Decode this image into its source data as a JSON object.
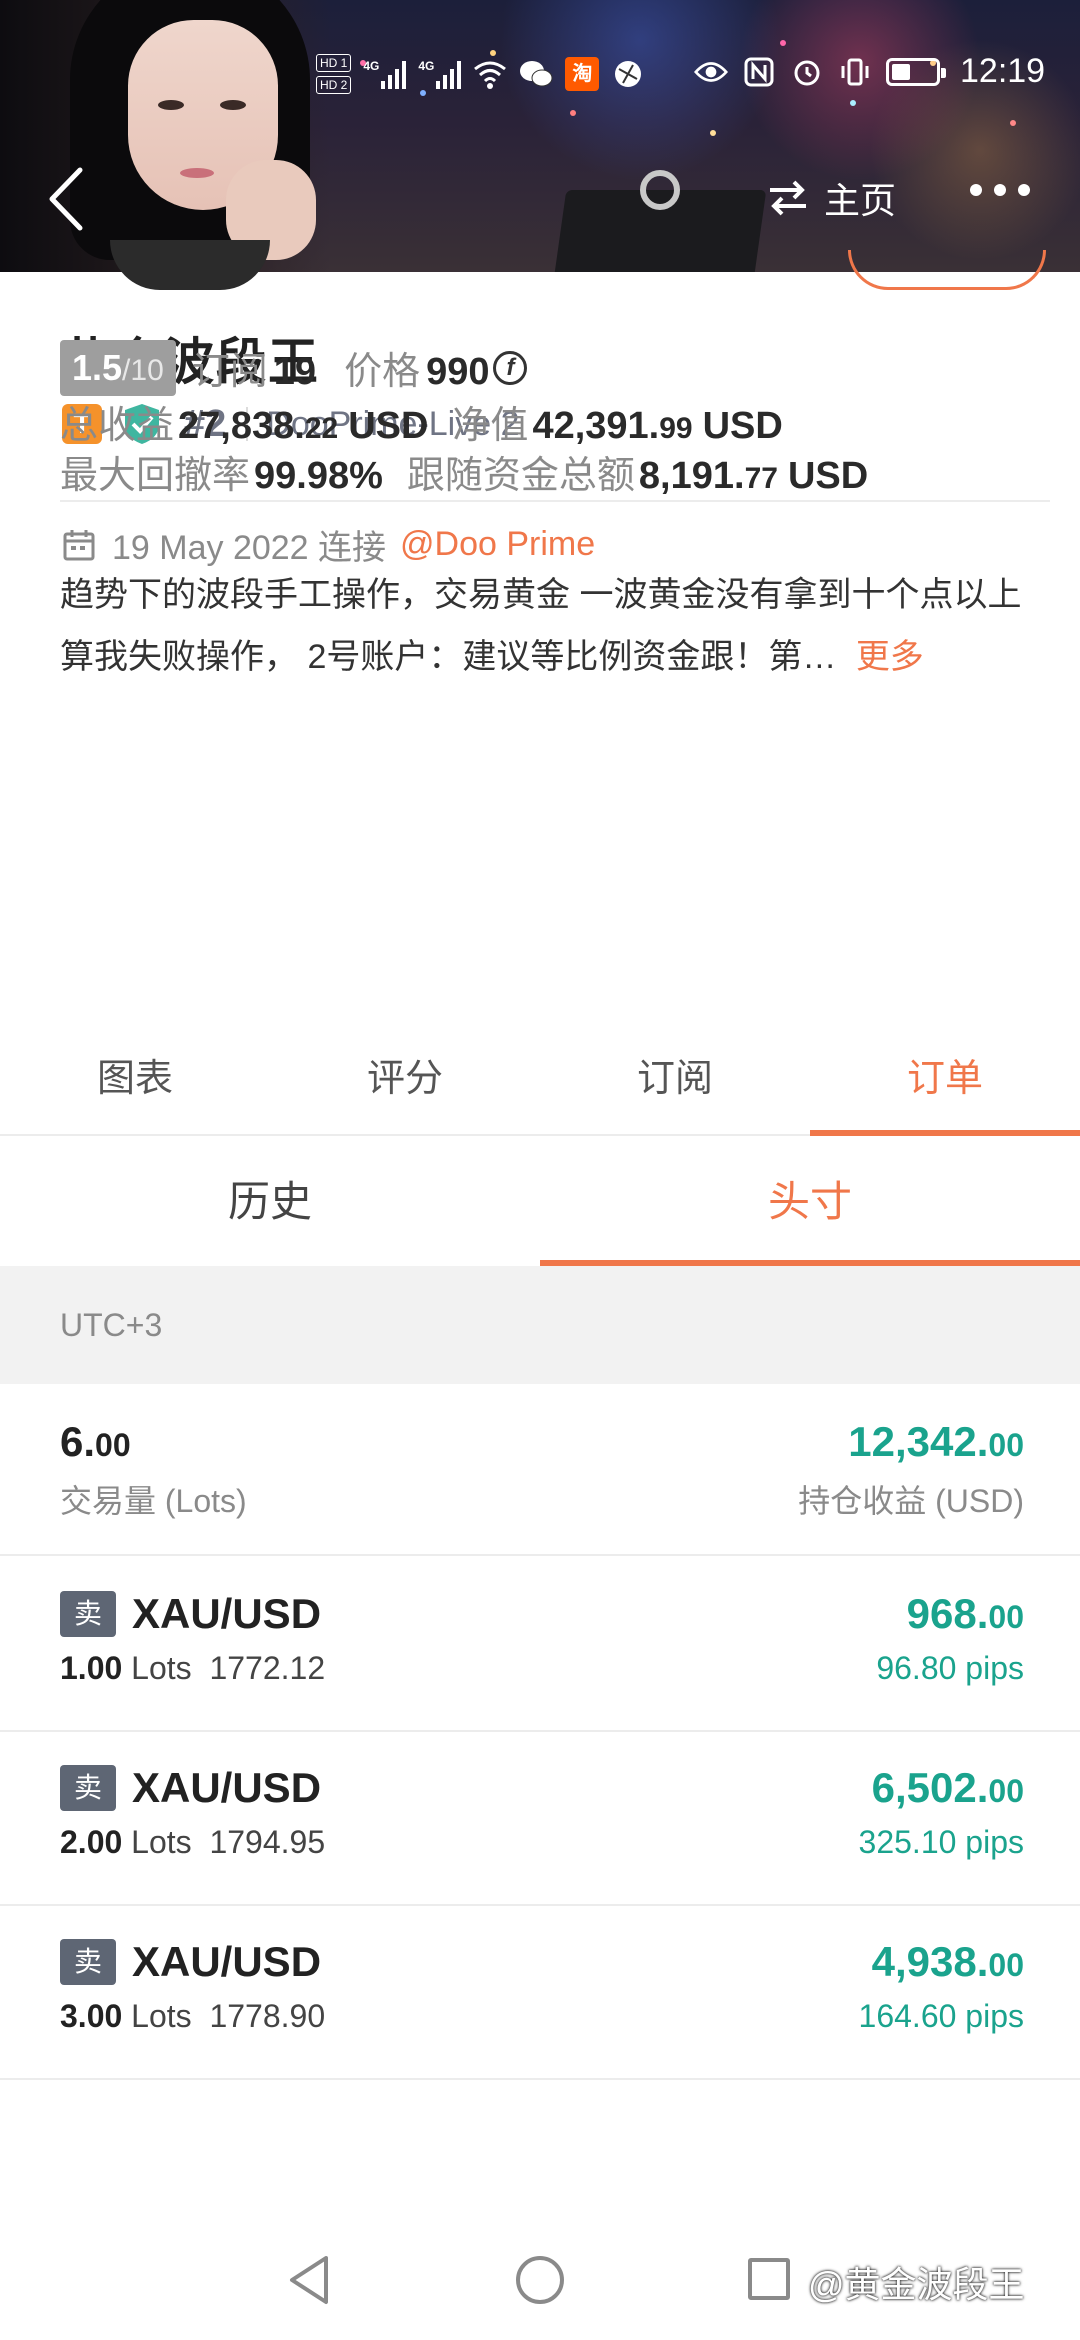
{
  "status_bar": {
    "hd1": "HD 1",
    "hd2": "HD 2",
    "net1": "4G",
    "net2": "4G",
    "taobao": "淘",
    "time": "12:19"
  },
  "header": {
    "home_label": "主页"
  },
  "profile": {
    "name": "黄金波段王",
    "level_badge": "T",
    "rank": "#2",
    "server": "DooPrime-Live 2",
    "score": "1.5",
    "score_max": "/10",
    "subscribe_label": "订阅",
    "subscribe_count": "19",
    "price_label": "价格",
    "price_value": "990",
    "price_currency_icon": "f",
    "total_profit_label": "总收益",
    "total_profit_int": "27,838.",
    "total_profit_dec": "22",
    "total_profit_unit": "USD",
    "net_value_label": "净值",
    "net_value_int": "42,391.",
    "net_value_dec": "99",
    "net_value_unit": "USD",
    "max_drawdown_label": "最大回撤率",
    "max_drawdown_value": "99.98%",
    "follow_funds_label": "跟随资金总额",
    "follow_funds_int": "8,191.",
    "follow_funds_dec": "77",
    "follow_funds_unit": "USD",
    "connect_date": "19 May 2022 连接",
    "broker": "@Doo Prime",
    "description": "趋势下的波段手工操作，交易黄金 一波黄金没有拿到十个点以上算我失败操作， 2号账户：建议等比例资金跟！第…",
    "more_label": "更多"
  },
  "tabs": [
    {
      "label": "图表",
      "active": false
    },
    {
      "label": "评分",
      "active": false
    },
    {
      "label": "订阅",
      "active": false
    },
    {
      "label": "订单",
      "active": true
    }
  ],
  "subtabs": [
    {
      "label": "历史",
      "active": false
    },
    {
      "label": "头寸",
      "active": true
    }
  ],
  "timezone": "UTC+3",
  "summary": {
    "volume_int": "6.",
    "volume_dec": "00",
    "volume_label": "交易量 (Lots)",
    "profit_int": "12,342.",
    "profit_dec": "00",
    "profit_label": "持仓收益 (USD)"
  },
  "positions": [
    {
      "side": "卖",
      "symbol": "XAU/USD",
      "lots": "1.00",
      "lots_unit": "Lots",
      "price": "1772.12",
      "profit_int": "968.",
      "profit_dec": "00",
      "pips": "96.80 pips"
    },
    {
      "side": "卖",
      "symbol": "XAU/USD",
      "lots": "2.00",
      "lots_unit": "Lots",
      "price": "1794.95",
      "profit_int": "6,502.",
      "profit_dec": "00",
      "pips": "325.10 pips"
    },
    {
      "side": "卖",
      "symbol": "XAU/USD",
      "lots": "3.00",
      "lots_unit": "Lots",
      "price": "1778.90",
      "profit_int": "4,938.",
      "profit_dec": "00",
      "pips": "164.60 pips"
    }
  ],
  "watermark": "@黄金波段王",
  "colors": {
    "accent": "#f0774a",
    "profit_green": "#1aa38d",
    "score_grey": "#9e9e9e",
    "sell_badge": "#5e6674"
  }
}
